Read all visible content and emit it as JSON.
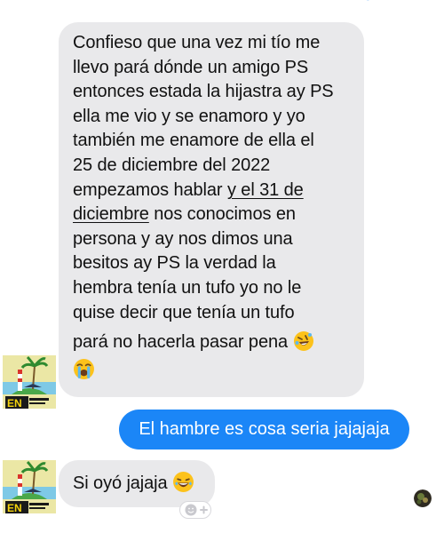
{
  "conversation": {
    "received_message_1": {
      "lines": [
        "Confieso que una vez mi tío me",
        "llevo pará dónde un amigo PS",
        "entonces estada la hijastra ay PS",
        "ella me vio y se enamoro y yo",
        "también me enamore de ella el",
        "25 de diciembre del 2022"
      ],
      "line7_part1": "empezamos hablar ",
      "line7_link": "y el 31 de",
      "line8_link": "diciembre",
      "line8_part2": " nos conocimos en",
      "lines_after": [
        "persona y ay nos dimos una",
        "besitos ay PS la verdad la",
        "hembra tenía un tufo yo no le",
        "quise decir que tenía un tufo"
      ],
      "last_line": "pará no hacerla pasar pena",
      "emojis": [
        "rolling-on-floor-laughing",
        "loudly-crying-face"
      ]
    },
    "sent_message": {
      "text": "El hambre es cosa seria jajajaja"
    },
    "received_message_2": {
      "text": "Si oyó jajaja",
      "emoji": "grinning-sweat-face"
    },
    "sender_avatar": {
      "logo_text": "EN"
    },
    "colors": {
      "incoming_bubble": "#e9e9eb",
      "outgoing_bubble": "#1b86f7",
      "incoming_text": "#111111",
      "outgoing_text": "#ffffff"
    },
    "icons": [
      "add-reaction-icon",
      "seen-avatar"
    ]
  }
}
